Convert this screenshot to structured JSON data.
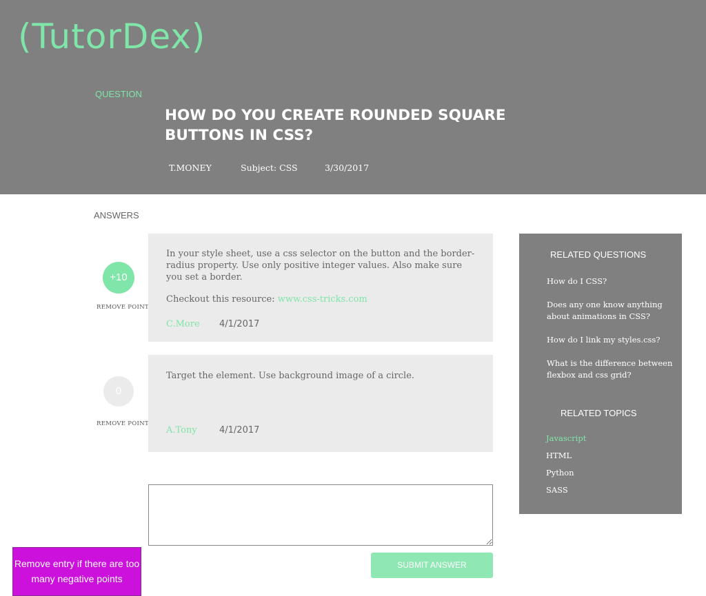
{
  "brand": {
    "logo": "(TutorDex)",
    "accent": "#7fe5a8"
  },
  "question": {
    "section_label": "QUESTION",
    "title": "HOW DO YOU CREATE ROUNDED SQUARE BUTTONS IN CSS?",
    "author": "T.MONEY",
    "subject": "Subject: CSS",
    "date": "3/30/2017"
  },
  "answers": {
    "section_label": "ANSWERS",
    "remove_point_label": "REMOVE POINT",
    "items": [
      {
        "points": "+10",
        "text": "In your style sheet, use a css selector on the button and the border-radius property. Use only positive integer values. Also make sure you set a border.",
        "resource_prefix": "Checkout this resource: ",
        "resource_link": "www.css-tricks.com",
        "author": "C.More",
        "date": "4/1/2017"
      },
      {
        "points": "0",
        "text": "Target the element. Use background image of a circle.",
        "author": "A.Tony",
        "date": "4/1/2017"
      }
    ]
  },
  "answer_form": {
    "input_value": "",
    "submit_label": "SUBMIT ANSWER"
  },
  "sidebar": {
    "related_questions_heading": "RELATED QUESTIONS",
    "related_questions": [
      "How do I CSS?",
      "Does any one know anything about animations in CSS?",
      "How do I link my styles.css?",
      "What is the difference between flexbox and css grid?"
    ],
    "related_topics_heading": "RELATED TOPICS",
    "related_topics": [
      "Javascript",
      "HTML",
      "Python",
      "SASS"
    ]
  },
  "note": {
    "text": "Remove entry if there are too many negative points",
    "color": "#cc11dd"
  }
}
